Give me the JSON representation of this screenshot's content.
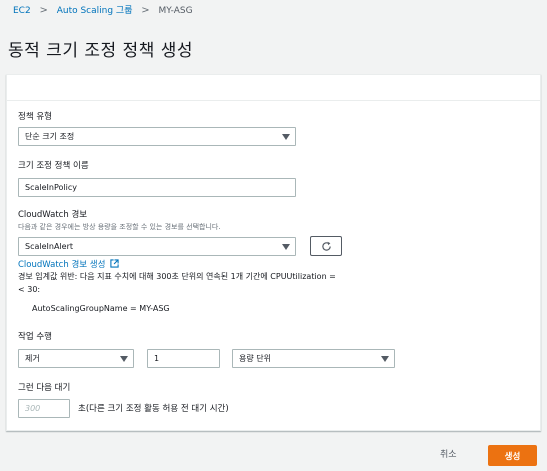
{
  "breadcrumb": {
    "items": [
      "EC2",
      "Auto Scaling 그룹",
      "MY-ASG"
    ]
  },
  "page": {
    "title": "동적 크기 조정 정책 생성"
  },
  "form": {
    "policy_type": {
      "label": "정책 유형",
      "value": "단순 크기 조정"
    },
    "policy_name": {
      "label": "크기 조정 정책 이름",
      "value": "ScaleInPolicy"
    },
    "alarm": {
      "label": "CloudWatch 경보",
      "description": "다음과 같은 경우에는 방상 용량을 조정할 수 있는 경보를 선택합니다.",
      "value": "ScaleInAlert",
      "create_link": "CloudWatch 경보 생성",
      "breach_text_line1": "경보 임계값 위반: 다음 지표 수치에 대해 300초 단위의 연속된 1개 기간에 CPUUtilization =",
      "breach_text_line2": "< 30:",
      "dimension": "AutoScalingGroupName = MY-ASG"
    },
    "action": {
      "label": "작업 수행",
      "operation": "제거",
      "amount": "1",
      "unit": "용량 단위"
    },
    "cooldown": {
      "label": "그런 다음 대기",
      "placeholder": "300",
      "suffix": "초(다른 크기 조정 활동 허용 전 대기 시간)"
    }
  },
  "footer": {
    "cancel_label": "취소",
    "create_label": "생성"
  },
  "colors": {
    "link": "#0073bb",
    "primary_button": "#ec7211",
    "background": "#f2f3f3"
  }
}
